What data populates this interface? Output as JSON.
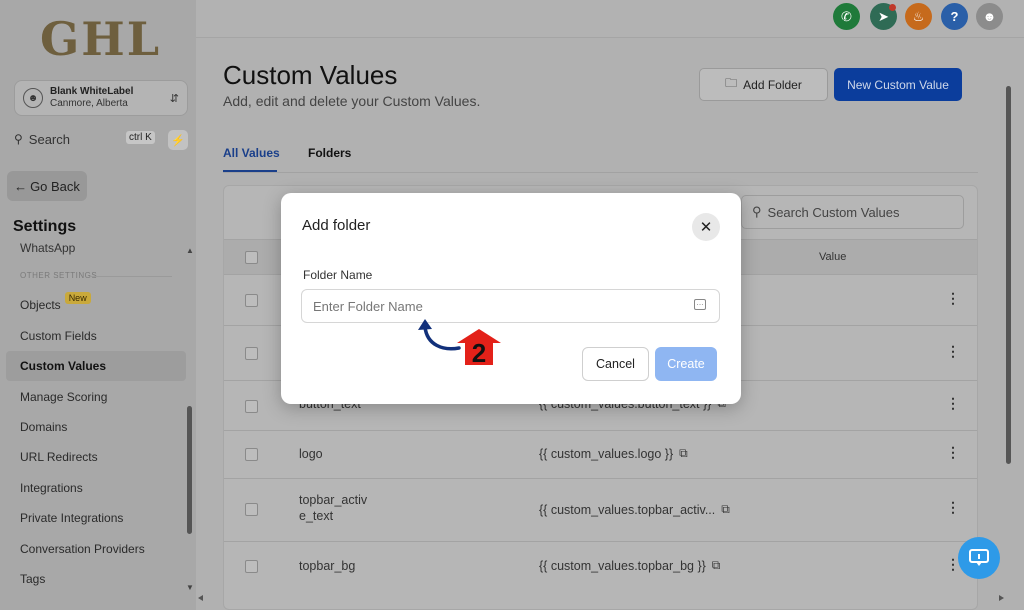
{
  "sidebar": {
    "logo": "GHL",
    "account": {
      "name": "Blank WhiteLabel",
      "location": "Canmore, Alberta"
    },
    "search": {
      "label": "Search",
      "shortcut": "ctrl K"
    },
    "go_back": "Go Back",
    "settings_title": "Settings",
    "partial_item": "WhatsApp",
    "section_label": "OTHER SETTINGS",
    "items": [
      {
        "label": "Objects",
        "badge": "New"
      },
      {
        "label": "Custom Fields"
      },
      {
        "label": "Custom Values"
      },
      {
        "label": "Manage Scoring"
      },
      {
        "label": "Domains"
      },
      {
        "label": "URL Redirects"
      },
      {
        "label": "Integrations"
      },
      {
        "label": "Private Integrations"
      },
      {
        "label": "Conversation Providers"
      },
      {
        "label": "Tags"
      }
    ]
  },
  "topbar": {
    "icons": [
      "phone-icon",
      "megaphone-icon",
      "bell-icon",
      "help-icon",
      "user-avatar"
    ]
  },
  "page": {
    "title": "Custom Values",
    "subtitle": "Add, edit and delete your Custom Values.",
    "add_folder_label": "Add Folder",
    "new_value_label": "New Custom Value",
    "tabs": [
      "All Values",
      "Folders"
    ],
    "search_placeholder": "Search Custom Values",
    "column_value": "Value"
  },
  "table": {
    "rows": [
      {
        "name": "",
        "value": ""
      },
      {
        "name": "",
        "value": ""
      },
      {
        "name": "button_text",
        "value": "{{ custom_values.button_text }}"
      },
      {
        "name": "logo",
        "value": "{{ custom_values.logo }}"
      },
      {
        "name": "topbar_activ\ne_text",
        "value": "{{ custom_values.topbar_activ..."
      },
      {
        "name": "topbar_bg",
        "value": "{{ custom_values.topbar_bg }}"
      }
    ]
  },
  "modal": {
    "title": "Add folder",
    "field_label": "Folder Name",
    "field_placeholder": "Enter Folder Name",
    "field_value": "",
    "cancel_label": "Cancel",
    "create_label": "Create"
  },
  "annotation": {
    "step_number": "2"
  },
  "colors": {
    "primary": "#0b3d9c",
    "create_disabled": "#8fb6f2",
    "marker_red": "#e32119",
    "arrow_navy": "#12307a",
    "chat": "#2e9ae8"
  }
}
